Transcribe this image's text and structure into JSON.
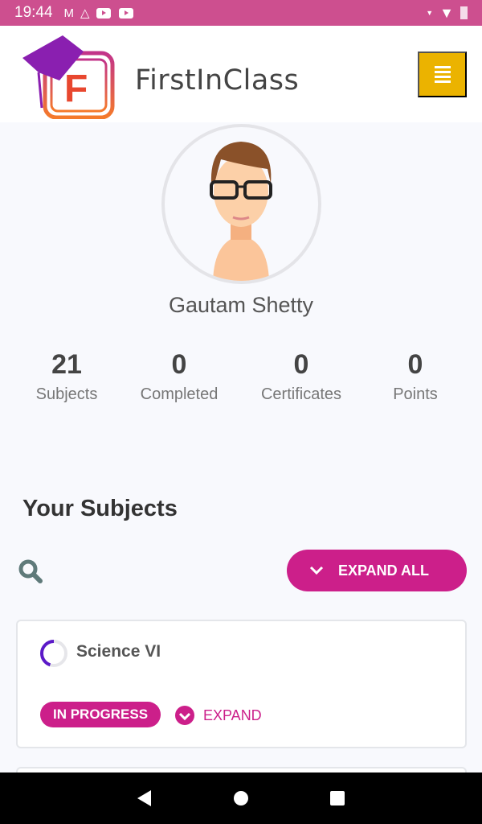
{
  "status_bar": {
    "time": "19:44",
    "icons": [
      "gmail-icon",
      "drive-icon",
      "youtube-icon",
      "youtube-icon"
    ],
    "right_icons": [
      "signal-icon",
      "wifi-icon",
      "battery-icon"
    ]
  },
  "header": {
    "brand": "FirstInClass",
    "logo_letter": "F",
    "menu_icon": "hamburger-icon"
  },
  "profile": {
    "name": "Gautam Shetty"
  },
  "stats": [
    {
      "value": "21",
      "label": "Subjects"
    },
    {
      "value": "0",
      "label": "Completed"
    },
    {
      "value": "0",
      "label": "Certificates"
    },
    {
      "value": "0",
      "label": "Points"
    }
  ],
  "subjects": {
    "title": "Your Subjects",
    "expand_all": "EXPAND ALL",
    "items": [
      {
        "name": "Science VI",
        "status": "IN PROGRESS",
        "progress_percent": 45,
        "expand": "EXPAND"
      }
    ]
  },
  "colors": {
    "accent": "#cc1f8a",
    "status_bar": "#cd4f8f",
    "menu_button": "#ebb300",
    "progress": "#5b19c8"
  }
}
